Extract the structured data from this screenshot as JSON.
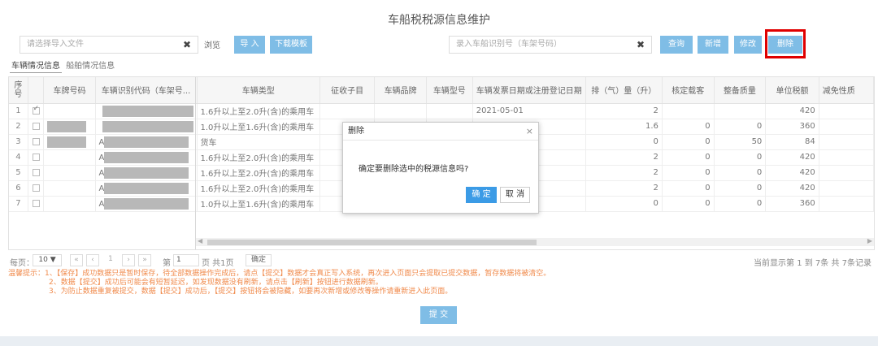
{
  "page": {
    "title": "车船税税源信息维护"
  },
  "toolbar": {
    "file_placeholder": "请选择导入文件",
    "clear_glyph": "✖",
    "browse_label": "浏览",
    "import_label": "导 入",
    "template_label": "下载模板",
    "search_placeholder": "录入车船识别号（车架号码）",
    "query_label": "查询",
    "add_label": "新增",
    "edit_label": "修改",
    "delete_label": "删除"
  },
  "tabs": [
    {
      "label": "车辆情况信息"
    },
    {
      "label": "船舶情况信息"
    }
  ],
  "grid": {
    "headers": {
      "seq": "序号",
      "plate": "车牌号码",
      "vin": "车辆识别代码（车架号...",
      "type": "车辆类型",
      "item": "征收子目",
      "brand": "车辆品牌",
      "model": "车辆型号",
      "date": "车辆发票日期或注册登记日期",
      "displacement": "排（气）量（升）",
      "seats": "核定载客",
      "mass": "整备质量",
      "unit_tax": "单位税额",
      "exempt": "减免性质"
    },
    "rows": [
      {
        "seq": "1",
        "checked": true,
        "type": "1.6升以上至2.0升(含)的乘用车",
        "date": "2021-05-01",
        "displacement": "2",
        "seats": "",
        "mass": "",
        "unit_tax": "420"
      },
      {
        "seq": "2",
        "checked": false,
        "type": "1.0升以上至1.6升(含)的乘用车",
        "date": "",
        "displacement": "1.6",
        "seats": "0",
        "mass": "0",
        "unit_tax": "360"
      },
      {
        "seq": "3",
        "checked": false,
        "vin_prefix": "A",
        "type": "货车",
        "date": "",
        "displacement": "0",
        "seats": "0",
        "mass": "50",
        "unit_tax": "84"
      },
      {
        "seq": "4",
        "checked": false,
        "vin_prefix": "A",
        "type": "1.6升以上至2.0升(含)的乘用车",
        "date": "",
        "displacement": "2",
        "seats": "0",
        "mass": "0",
        "unit_tax": "420"
      },
      {
        "seq": "5",
        "checked": false,
        "vin_prefix": "A",
        "type": "1.6升以上至2.0升(含)的乘用车",
        "date": "",
        "displacement": "2",
        "seats": "0",
        "mass": "0",
        "unit_tax": "420"
      },
      {
        "seq": "6",
        "checked": false,
        "vin_prefix": "A",
        "type": "1.6升以上至2.0升(含)的乘用车",
        "date": "",
        "displacement": "2",
        "seats": "0",
        "mass": "0",
        "unit_tax": "420"
      },
      {
        "seq": "7",
        "checked": false,
        "vin_prefix": "A",
        "type": "1.0升以上至1.6升(含)的乘用车",
        "date": "",
        "displacement": "0",
        "seats": "0",
        "mass": "0",
        "unit_tax": "360"
      }
    ]
  },
  "pager": {
    "per_page_label": "每页：",
    "per_page_value": "10",
    "first": "«",
    "prev": "‹",
    "page_no": "1",
    "next": "›",
    "last": "»",
    "page_prefix": "第",
    "page_input": "1",
    "page_suffix": "页 共1页",
    "confirm_label": "确定",
    "summary": "当前显示第  1 到  7条 共  7条记录"
  },
  "hints": {
    "line1": "温馨提示：1、【保存】成功数据只是暂时保存，待全部数据操作完成后，请点【提交】数据才会真正写入系统，再次进入页面只会提取已提交数据，暂存数据将被清空。",
    "line2": "2、数据【提交】成功后可能会有短暂延迟，如发现数据没有刷新，请点击【刷新】按钮进行数据刷新。",
    "line3": "3、为防止数据重复被提交，数据【提交】成功后，【提交】按钮将会被隐藏，如要再次新增或修改等操作请重新进入此页面。"
  },
  "submit_label": "提 交",
  "dialog": {
    "title": "删除",
    "close_glyph": "×",
    "message": "确定要删除选中的税源信息吗?",
    "ok_label": "确 定",
    "cancel_label": "取 消"
  },
  "colors": {
    "primary": "#7fbde6",
    "dialog_ok": "#3b9be6",
    "highlight": "#e00000",
    "hint": "#f08a4b"
  }
}
